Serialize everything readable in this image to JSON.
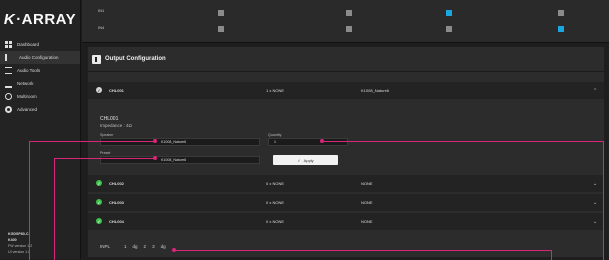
{
  "app": {
    "logo_mark": "K",
    "logo_text": "·ARRAY"
  },
  "sidebar": {
    "items": [
      {
        "label": "Dashboard",
        "icon": "dashboard-icon"
      },
      {
        "label": "Audio Configuration",
        "icon": "speaker-icon",
        "active": true
      },
      {
        "label": "Audio Tools",
        "icon": "tools-icon"
      },
      {
        "label": "Network",
        "icon": "network-icon"
      },
      {
        "label": "Multiroom",
        "icon": "multiroom-icon"
      },
      {
        "label": "Advanced",
        "icon": "gear-icon"
      }
    ],
    "system": {
      "name": "KGDSP80-C",
      "model": "K400",
      "line1": "FW version 1.2",
      "line2": "UI version 1.0"
    }
  },
  "matrix": {
    "rows": [
      "IN1",
      "IN4"
    ],
    "state_colors": {
      "on": "#1aa6e0",
      "off": "#8b8b8b"
    }
  },
  "panel": {
    "title": "Output Configuration"
  },
  "channels": [
    {
      "name": "CHL001",
      "signal": "1 x NONE",
      "preset": "K1008_Nature6",
      "status": "grey",
      "expanded": true
    },
    {
      "name": "CHL002",
      "signal": "0 x NONE",
      "preset": "NONE",
      "status": "green"
    },
    {
      "name": "CHL003",
      "signal": "0 x NONE",
      "preset": "NONE",
      "status": "green"
    },
    {
      "name": "CHL004",
      "signal": "0 x NONE",
      "preset": "NONE",
      "status": "green"
    }
  ],
  "detail": {
    "title": "CHL001",
    "impedance": "Impedance : 4Ω",
    "speaker_label": "Speaker",
    "speaker_value": "K1008_Nature6",
    "quantity_label": "Quantity",
    "quantity_value": "1",
    "preset_label": "Preset",
    "preset_value": "K1008_Nature6",
    "apply_label": "Apply"
  },
  "pager": {
    "label": "INPL",
    "items": [
      "1",
      "dg",
      "2",
      "3",
      "dg"
    ]
  },
  "colors": {
    "accent": "#d8267a",
    "ok": "#3ec14d"
  }
}
